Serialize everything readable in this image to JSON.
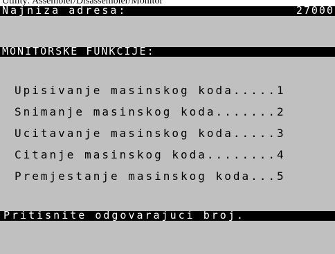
{
  "caption": "Utility: Assembler/Disassembler/Monitor",
  "header": {
    "label": "Najniza adresa:",
    "value": "27000"
  },
  "section_title": "MONITORSKE FUNKCIJE:",
  "menu": {
    "items": [
      "Upisivanje masinskog koda.....1",
      "Snimanje masinskog koda.......2",
      "Ucitavanje masinskog koda.....3",
      "Citanje masinskog koda........4",
      "Premjestanje masinskog koda...5"
    ]
  },
  "prompt": "Pritisnite odgovarajuci broj.",
  "colors": {
    "screen": "#c0c0c0",
    "bar": "#000000",
    "bar_text": "#ffffff"
  }
}
